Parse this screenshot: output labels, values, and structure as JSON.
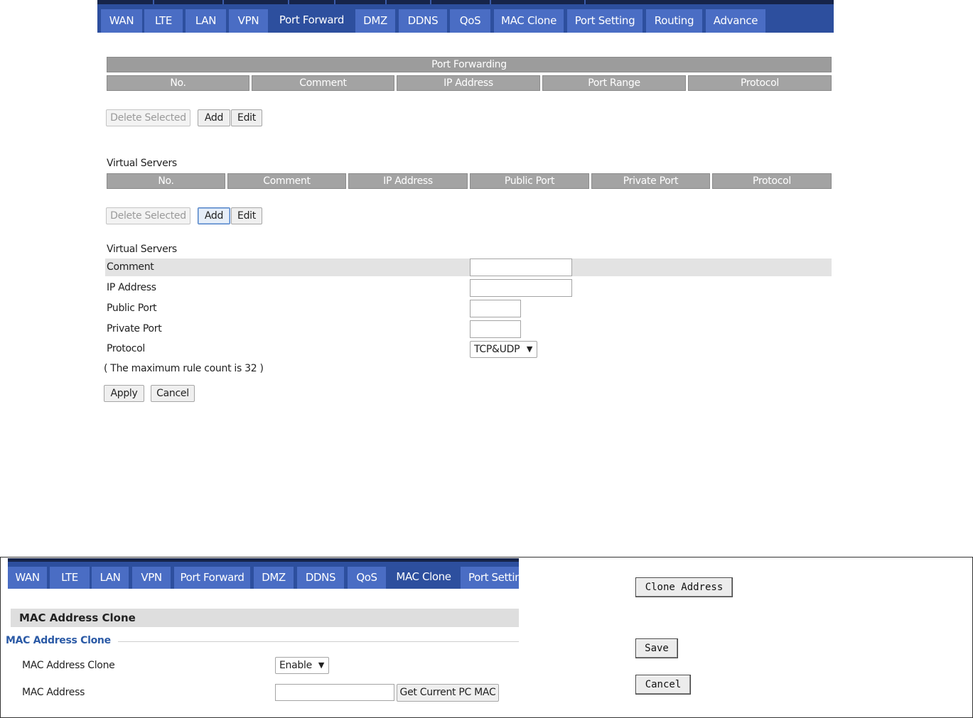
{
  "top_nav": {
    "tabs": [
      "WAN",
      "LTE",
      "LAN",
      "VPN",
      "Port Forward",
      "DMZ",
      "DDNS",
      "QoS",
      "MAC Clone",
      "Port Setting",
      "Routing",
      "Advance"
    ],
    "active": "Port Forward"
  },
  "port_forwarding": {
    "title": "Port Forwarding",
    "columns": [
      "No.",
      "Comment",
      "IP Address",
      "Port Range",
      "Protocol"
    ],
    "buttons": {
      "delete": "Delete Selected",
      "add": "Add",
      "edit": "Edit"
    }
  },
  "virtual_servers_table": {
    "title": "Virtual Servers",
    "columns": [
      "No.",
      "Comment",
      "IP Address",
      "Public Port",
      "Private Port",
      "Protocol"
    ],
    "buttons": {
      "delete": "Delete Selected",
      "add": "Add",
      "edit": "Edit"
    }
  },
  "virtual_servers_form": {
    "title": "Virtual Servers",
    "fields": {
      "comment": {
        "label": "Comment",
        "value": ""
      },
      "ip_address": {
        "label": "IP Address",
        "value": ""
      },
      "public_port": {
        "label": "Public Port",
        "value": ""
      },
      "private_port": {
        "label": "Private Port",
        "value": ""
      },
      "protocol": {
        "label": "Protocol",
        "value": "TCP&UDP"
      }
    },
    "note": "( The maximum rule count is 32 )",
    "apply": "Apply",
    "cancel": "Cancel"
  },
  "mac_panel": {
    "tabs": [
      "WAN",
      "LTE",
      "LAN",
      "VPN",
      "Port Forward",
      "DMZ",
      "DDNS",
      "QoS",
      "MAC Clone",
      "Port Setting"
    ],
    "active": "MAC Clone",
    "section_title": "MAC Address Clone",
    "legend": "MAC Address Clone",
    "clone_label": "MAC Address Clone",
    "clone_value": "Enable",
    "mac_label": "MAC Address",
    "mac_value": "",
    "get_mac_button": "Get Current PC MAC",
    "clone_address_button": "Clone Address",
    "save_button": "Save",
    "cancel_button": "Cancel"
  },
  "colors": {
    "nav_dark": "#2d4f9e",
    "nav_tab": "#4a6dc4",
    "header_gray": "#a3a3a3",
    "legend_blue": "#2b5aa6"
  }
}
